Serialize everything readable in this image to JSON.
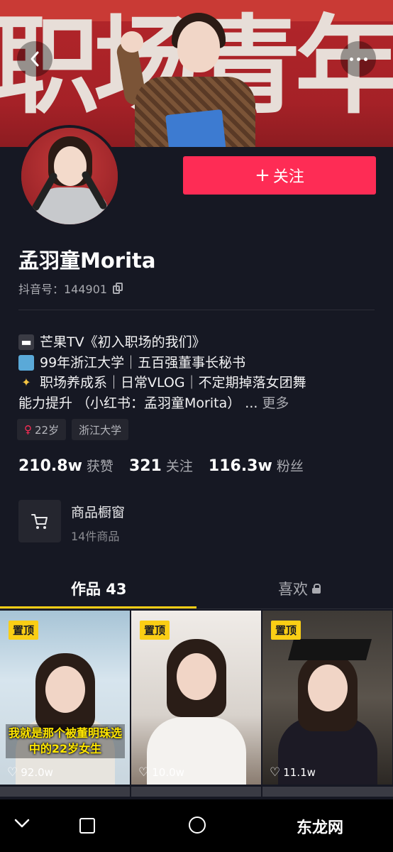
{
  "banner": {
    "bg_text": "职场青年"
  },
  "profile": {
    "name": "孟羽童Morita",
    "douyin_id": "抖音号：144901",
    "follow_label": "关注",
    "follow_plus": "+"
  },
  "bio": {
    "line1": "芒果TV《初入职场的我们》",
    "line2": "99年浙江大学｜五百强董事长秘书",
    "line3": "职场养成系｜日常VLOG｜不定期掉落女团舞",
    "line4": "能力提升 （小红书：孟羽童Morita） ...",
    "more": "更多"
  },
  "tags": {
    "age": "22岁",
    "school": "浙江大学"
  },
  "stats": {
    "likes_num": "210.8w",
    "likes_label": "获赞",
    "following_num": "321",
    "following_label": "关注",
    "fans_num": "116.3w",
    "fans_label": "粉丝"
  },
  "shop": {
    "title": "商品橱窗",
    "subtitle": "14件商品"
  },
  "tabs": {
    "works": "作品 43",
    "likes": "喜欢"
  },
  "videos": [
    {
      "pin": "置顶",
      "likes": "92.0w",
      "caption": "我就是那个被董明珠选中的22岁女生"
    },
    {
      "pin": "置顶",
      "likes": "10.0w"
    },
    {
      "pin": "置顶",
      "likes": "11.1w"
    }
  ],
  "watermark": "东龙网",
  "colors": {
    "accent": "#fe2c55",
    "highlight": "#face15",
    "background": "#161823"
  }
}
